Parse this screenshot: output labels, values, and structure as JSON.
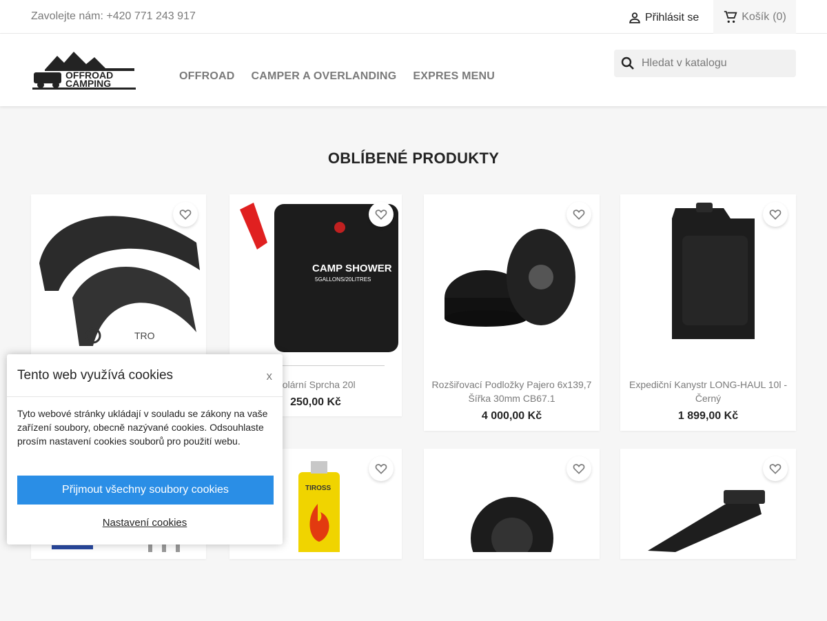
{
  "topbar": {
    "contact": "Zavolejte nám: +420 771 243 917",
    "login_label": "Přihlásit se",
    "cart_label": "Košík",
    "cart_count": "(0)"
  },
  "header": {
    "logo_text_line1": "OFFROAD",
    "logo_text_line2": "CAMPING",
    "menu": [
      "OFFROAD",
      "CAMPER A OVERLANDING",
      "EXPRES MENU"
    ],
    "search_placeholder": "Hledat v katalogu"
  },
  "section_title": "OBLÍBENÉ PRODUKTY",
  "products": [
    {
      "name": "",
      "price": ""
    },
    {
      "name": "Solární Sprcha 20l",
      "price": "250,00 Kč",
      "image_text": "CAMP SHOWER",
      "image_subtext": "5GALLONS/20LITRES"
    },
    {
      "name": "Rozšiřovací Podložky Pajero 6x139,7 Šířka 30mm CB67.1",
      "price": "4 000,00 Kč"
    },
    {
      "name": "Expediční Kanystr LONG-HAUL 10l - Černý",
      "price": "1 899,00 Kč"
    }
  ],
  "product_row2": [
    {
      "image_text": "TIROSS"
    },
    {},
    {},
    {}
  ],
  "cookie": {
    "title": "Tento web využívá cookies",
    "close": "x",
    "text": "Tyto webové stránky ukládají v souladu se zákony na vaše zařízení soubory, obecně nazývané cookies. Odsouhlaste prosím nastavení cookies souborů pro použití webu.",
    "accept_label": "Přijmout všechny soubory cookies",
    "settings_label": "Nastavení cookies"
  },
  "colors": {
    "accent": "#2a8ee6",
    "text_dark": "#232323",
    "text_muted": "#7a7a7a"
  }
}
